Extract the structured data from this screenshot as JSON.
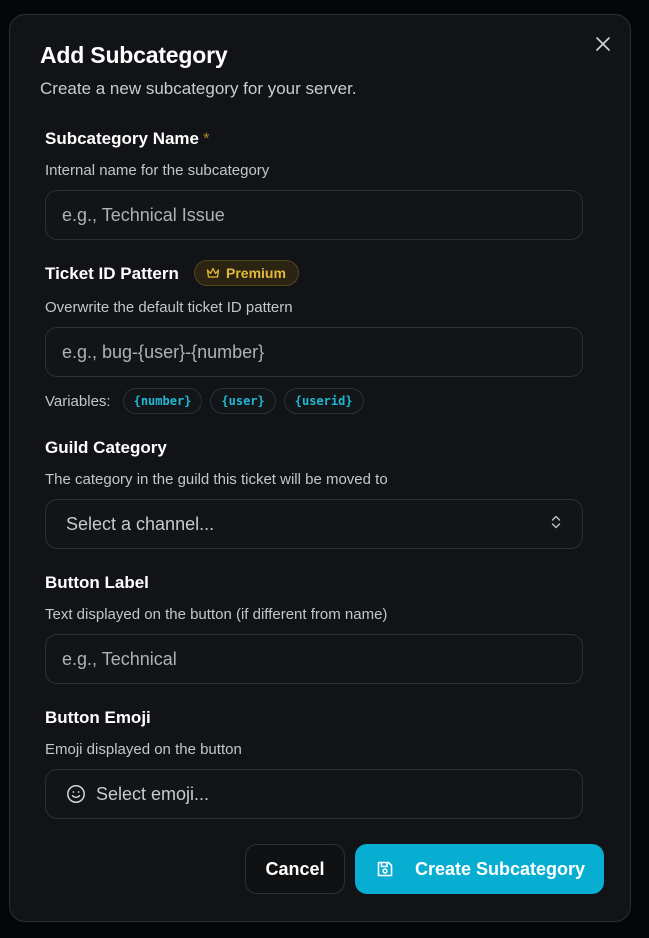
{
  "dialog": {
    "title": "Add Subcategory",
    "subtitle": "Create a new subcategory for your server."
  },
  "fields": {
    "name": {
      "label": "Subcategory Name",
      "required_mark": "*",
      "description": "Internal name for the subcategory",
      "placeholder": "e.g., Technical Issue",
      "value": ""
    },
    "ticket_id_pattern": {
      "label": "Ticket ID Pattern",
      "badge": "Premium",
      "description": "Overwrite the default ticket ID pattern",
      "placeholder": "e.g., bug-{user}-{number}",
      "value": "",
      "variables_label": "Variables:",
      "variables": [
        "{number}",
        "{user}",
        "{userid}"
      ]
    },
    "guild_category": {
      "label": "Guild Category",
      "description": "The category in the guild this ticket will be moved to",
      "selected": "Select a channel..."
    },
    "button_label": {
      "label": "Button Label",
      "description": "Text displayed on the button (if different from name)",
      "placeholder": "e.g., Technical",
      "value": ""
    },
    "button_emoji": {
      "label": "Button Emoji",
      "description": "Emoji displayed on the button",
      "selected": "Select emoji..."
    }
  },
  "actions": {
    "cancel_label": "Cancel",
    "create_label": "Create Subcategory"
  },
  "icons": {
    "close": "close-icon",
    "premium": "crown-icon",
    "select": "chevrons-up-down-icon",
    "emoji": "smile-icon",
    "create": "save-icon"
  },
  "colors": {
    "background": "#050607",
    "dialog": "#111316",
    "accent": "#07aed2",
    "premium": "#e3b93a",
    "variable": "#22b8d4"
  }
}
